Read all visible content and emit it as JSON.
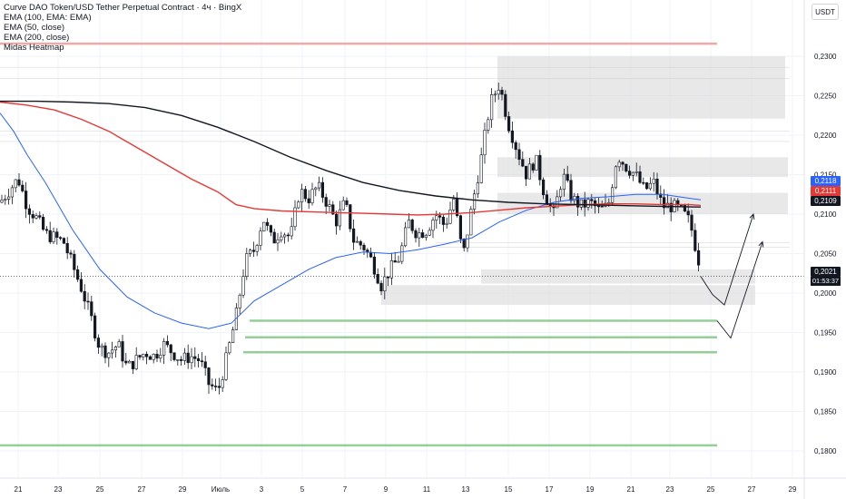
{
  "legend": {
    "title": "Curve DAO Token/USD Tether Perpetual Contract · 4ч · BingX",
    "ema100": "EMA (100, EMA: EMA)",
    "ema50": "EMA (50, close)",
    "ema200": "EMA (200, close)",
    "heatmap": "Midas Heatmap"
  },
  "currency_button": "USDT",
  "price_tags": {
    "ema50": "0,2118",
    "ema200": "0,2111",
    "ema100": "0,2109",
    "last": "0,2021",
    "countdown": "01:53:37"
  },
  "colors": {
    "ema50": "#2962ff",
    "ema200": "#e53935",
    "ema100": "#131722",
    "up": "#ffffff",
    "down": "#131722",
    "support": "#81c784",
    "resistance": "#ef9a9a",
    "heatmap": "#d5d5d5"
  },
  "chart_data": {
    "type": "candlestick",
    "title": "Curve DAO Token/USD Tether Perpetual Contract · 4ч · BingX",
    "ylim": [
      0.1785,
      0.2335
    ],
    "y_ticks": [
      "0,2300",
      "0,2250",
      "0,2200",
      "0,2150",
      "0,2100",
      "0,2050",
      "0,2000",
      "0,1950",
      "0,1900",
      "0,1850",
      "0,1800"
    ],
    "x_ticks": [
      "21",
      "23",
      "25",
      "27",
      "29",
      "Июль",
      "3",
      "5",
      "7",
      "9",
      "11",
      "13",
      "15",
      "17",
      "19",
      "21",
      "23",
      "25",
      "27",
      "29"
    ],
    "grid": true,
    "candle_anchors": [
      [
        0,
        0.2115
      ],
      [
        10,
        0.213
      ],
      [
        20,
        0.2145
      ],
      [
        30,
        0.211
      ],
      [
        40,
        0.2095
      ],
      [
        50,
        0.2075
      ],
      [
        60,
        0.207
      ],
      [
        70,
        0.2065
      ],
      [
        80,
        0.2035
      ],
      [
        90,
        0.2005
      ],
      [
        100,
        0.197
      ],
      [
        110,
        0.193
      ],
      [
        120,
        0.1925
      ],
      [
        130,
        0.1935
      ],
      [
        140,
        0.1905
      ],
      [
        150,
        0.1915
      ],
      [
        160,
        0.1925
      ],
      [
        170,
        0.192
      ],
      [
        180,
        0.1935
      ],
      [
        190,
        0.1925
      ],
      [
        200,
        0.1915
      ],
      [
        210,
        0.192
      ],
      [
        220,
        0.1915
      ],
      [
        230,
        0.1885
      ],
      [
        240,
        0.1875
      ],
      [
        250,
        0.192
      ],
      [
        260,
        0.197
      ],
      [
        270,
        0.204
      ],
      [
        280,
        0.2055
      ],
      [
        290,
        0.2095
      ],
      [
        300,
        0.2065
      ],
      [
        310,
        0.208
      ],
      [
        320,
        0.207
      ],
      [
        330,
        0.213
      ],
      [
        340,
        0.212
      ],
      [
        350,
        0.2135
      ],
      [
        360,
        0.2115
      ],
      [
        370,
        0.209
      ],
      [
        380,
        0.2115
      ],
      [
        390,
        0.2065
      ],
      [
        400,
        0.206
      ],
      [
        410,
        0.204
      ],
      [
        420,
        0.201
      ],
      [
        430,
        0.203
      ],
      [
        440,
        0.2045
      ],
      [
        450,
        0.209
      ],
      [
        460,
        0.2075
      ],
      [
        470,
        0.208
      ],
      [
        480,
        0.21
      ],
      [
        490,
        0.2085
      ],
      [
        500,
        0.212
      ],
      [
        510,
        0.2045
      ],
      [
        520,
        0.211
      ],
      [
        530,
        0.217
      ],
      [
        540,
        0.224
      ],
      [
        550,
        0.2265
      ],
      [
        560,
        0.2215
      ],
      [
        570,
        0.218
      ],
      [
        580,
        0.215
      ],
      [
        590,
        0.217
      ],
      [
        600,
        0.2125
      ],
      [
        610,
        0.21
      ],
      [
        620,
        0.215
      ],
      [
        630,
        0.212
      ],
      [
        640,
        0.211
      ],
      [
        650,
        0.2115
      ],
      [
        660,
        0.2105
      ],
      [
        670,
        0.211
      ],
      [
        680,
        0.2175
      ],
      [
        690,
        0.216
      ],
      [
        700,
        0.215
      ],
      [
        710,
        0.213
      ],
      [
        720,
        0.214
      ],
      [
        730,
        0.211
      ],
      [
        740,
        0.211
      ],
      [
        750,
        0.2105
      ],
      [
        760,
        0.209
      ],
      [
        770,
        0.204
      ],
      [
        772,
        0.2021
      ]
    ],
    "series": [
      {
        "name": "EMA (50, close)",
        "color": "#2962ff",
        "points": [
          [
            0,
            0.2228
          ],
          [
            15,
            0.2205
          ],
          [
            30,
            0.2175
          ],
          [
            50,
            0.214
          ],
          [
            80,
            0.208
          ],
          [
            110,
            0.203
          ],
          [
            140,
            0.1995
          ],
          [
            170,
            0.1975
          ],
          [
            200,
            0.1962
          ],
          [
            230,
            0.1955
          ],
          [
            255,
            0.1962
          ],
          [
            280,
            0.199
          ],
          [
            310,
            0.201
          ],
          [
            340,
            0.203
          ],
          [
            370,
            0.2045
          ],
          [
            400,
            0.2052
          ],
          [
            430,
            0.205
          ],
          [
            460,
            0.2055
          ],
          [
            490,
            0.2062
          ],
          [
            520,
            0.207
          ],
          [
            550,
            0.209
          ],
          [
            580,
            0.2105
          ],
          [
            610,
            0.2115
          ],
          [
            640,
            0.212
          ],
          [
            670,
            0.2122
          ],
          [
            700,
            0.2125
          ],
          [
            730,
            0.2125
          ],
          [
            760,
            0.212
          ],
          [
            772,
            0.2118
          ]
        ]
      },
      {
        "name": "EMA (200, close)",
        "color": "#e53935",
        "points": [
          [
            0,
            0.2242
          ],
          [
            30,
            0.2238
          ],
          [
            60,
            0.2232
          ],
          [
            90,
            0.222
          ],
          [
            120,
            0.2205
          ],
          [
            150,
            0.2185
          ],
          [
            180,
            0.2165
          ],
          [
            210,
            0.2145
          ],
          [
            240,
            0.2128
          ],
          [
            260,
            0.2112
          ],
          [
            280,
            0.2107
          ],
          [
            310,
            0.2104
          ],
          [
            340,
            0.2103
          ],
          [
            370,
            0.2102
          ],
          [
            400,
            0.2101
          ],
          [
            430,
            0.21
          ],
          [
            460,
            0.2099
          ],
          [
            490,
            0.21
          ],
          [
            520,
            0.2102
          ],
          [
            550,
            0.2105
          ],
          [
            580,
            0.2108
          ],
          [
            610,
            0.211
          ],
          [
            640,
            0.2112
          ],
          [
            670,
            0.2113
          ],
          [
            700,
            0.2113
          ],
          [
            730,
            0.2112
          ],
          [
            760,
            0.2112
          ],
          [
            772,
            0.2111
          ]
        ]
      },
      {
        "name": "EMA (100, EMA: EMA)",
        "color": "#131722",
        "points": [
          [
            0,
            0.2243
          ],
          [
            40,
            0.2243
          ],
          [
            80,
            0.2242
          ],
          [
            120,
            0.224
          ],
          [
            160,
            0.2235
          ],
          [
            200,
            0.2225
          ],
          [
            240,
            0.221
          ],
          [
            280,
            0.2192
          ],
          [
            320,
            0.2172
          ],
          [
            360,
            0.2155
          ],
          [
            400,
            0.214
          ],
          [
            440,
            0.213
          ],
          [
            480,
            0.2123
          ],
          [
            520,
            0.2118
          ],
          [
            560,
            0.2115
          ],
          [
            600,
            0.2113
          ],
          [
            640,
            0.2112
          ],
          [
            680,
            0.2111
          ],
          [
            720,
            0.211
          ],
          [
            772,
            0.2109
          ]
        ]
      }
    ],
    "last_price": 0.2021,
    "horizontal_levels": [
      {
        "price": 0.2316,
        "type": "resistance",
        "x_end": 790
      },
      {
        "price": 0.1965,
        "type": "support",
        "x_start": 275,
        "x_end": 790
      },
      {
        "price": 0.1944,
        "type": "support",
        "x_start": 270,
        "x_end": 790
      },
      {
        "price": 0.1925,
        "type": "support",
        "x_start": 268,
        "x_end": 790
      },
      {
        "price": 0.1807,
        "type": "support",
        "x_start": 0,
        "x_end": 790
      }
    ],
    "heatmap_zones": [
      {
        "price_low": 0.2221,
        "price_high": 0.23,
        "x_start": 548,
        "x_end": 865
      },
      {
        "price_low": 0.2147,
        "price_high": 0.2172,
        "x_start": 548,
        "x_end": 868
      },
      {
        "price_low": 0.21,
        "price_high": 0.2127,
        "x_start": 548,
        "x_end": 868
      },
      {
        "price_low": 0.1985,
        "price_high": 0.201,
        "x_start": 420,
        "x_end": 832
      },
      {
        "price_low": 0.2012,
        "price_high": 0.203,
        "x_start": 530,
        "x_end": 832
      }
    ],
    "projection_paths": [
      [
        [
          772,
          0.2021
        ],
        [
          785,
          0.1998
        ],
        [
          798,
          0.1985
        ],
        [
          830,
          0.21
        ]
      ],
      [
        [
          790,
          0.1965
        ],
        [
          805,
          0.1943
        ],
        [
          840,
          0.2065
        ]
      ]
    ]
  }
}
